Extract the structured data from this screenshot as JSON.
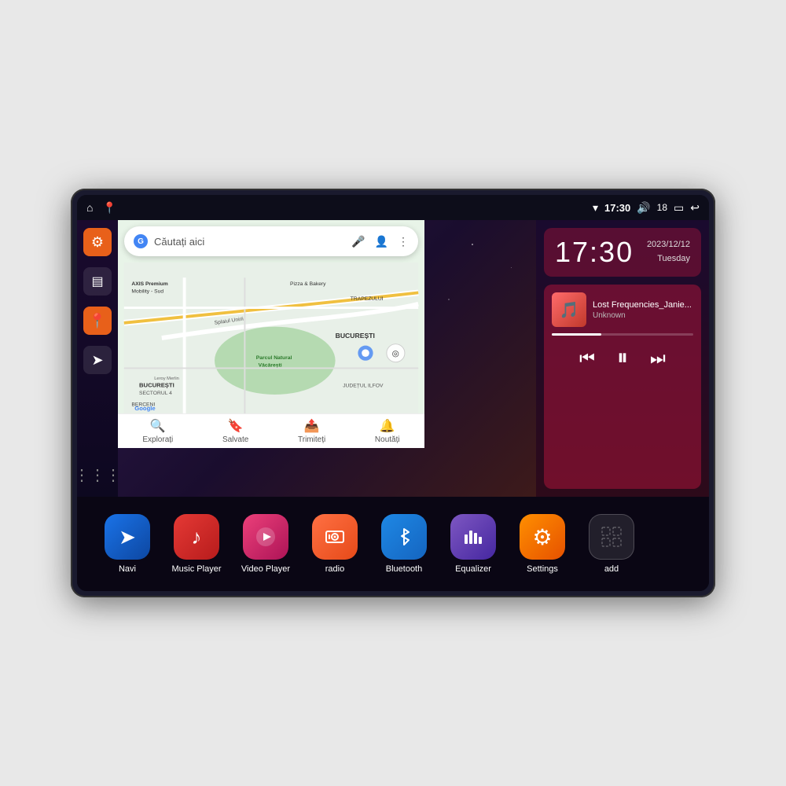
{
  "device": {
    "status_bar": {
      "left_icons": [
        "home",
        "maps"
      ],
      "time": "17:30",
      "right_icons": [
        "wifi",
        "volume",
        "battery",
        "back"
      ],
      "signal_strength": "18"
    }
  },
  "sidebar": {
    "items": [
      {
        "name": "settings",
        "label": "Settings",
        "color": "orange"
      },
      {
        "name": "files",
        "label": "Files",
        "color": "dark"
      },
      {
        "name": "maps",
        "label": "Maps",
        "color": "orange"
      },
      {
        "name": "navigation",
        "label": "Navigation",
        "color": "dark"
      },
      {
        "name": "grid",
        "label": "Grid",
        "color": "grid"
      }
    ]
  },
  "maps": {
    "search_placeholder": "Căutați aici",
    "bottom_tabs": [
      {
        "icon": "🔍",
        "label": "Explorați"
      },
      {
        "icon": "🔖",
        "label": "Salvate"
      },
      {
        "icon": "📤",
        "label": "Trimiteți"
      },
      {
        "icon": "🔔",
        "label": "Noutăți"
      }
    ],
    "poi": [
      "AXIS Premium Mobility - Sud",
      "Pizza & Bakery",
      "TRAPEZULUI",
      "Parcul Natural Văcărești",
      "BUCUREȘTI",
      "SECTORUL 4",
      "JUDEȚUL ILFOV",
      "BERCENI",
      "Leroy Merlin",
      "Google"
    ]
  },
  "clock": {
    "time": "17:30",
    "date": "2023/12/12",
    "day": "Tuesday"
  },
  "music": {
    "title": "Lost Frequencies_Janie...",
    "artist": "Unknown",
    "progress": 35
  },
  "apps": [
    {
      "id": "navi",
      "label": "Navi",
      "color": "blue",
      "icon": "➤"
    },
    {
      "id": "music-player",
      "label": "Music Player",
      "color": "red",
      "icon": "♪"
    },
    {
      "id": "video-player",
      "label": "Video Player",
      "color": "pink",
      "icon": "▶"
    },
    {
      "id": "radio",
      "label": "radio",
      "color": "orange-radio",
      "icon": "📻"
    },
    {
      "id": "bluetooth",
      "label": "Bluetooth",
      "color": "blue-bt",
      "icon": "⚡"
    },
    {
      "id": "equalizer",
      "label": "Equalizer",
      "color": "purple",
      "icon": "🎚"
    },
    {
      "id": "settings",
      "label": "Settings",
      "color": "orange-set",
      "icon": "⚙"
    },
    {
      "id": "add",
      "label": "add",
      "color": "gray-add",
      "icon": "+"
    }
  ]
}
